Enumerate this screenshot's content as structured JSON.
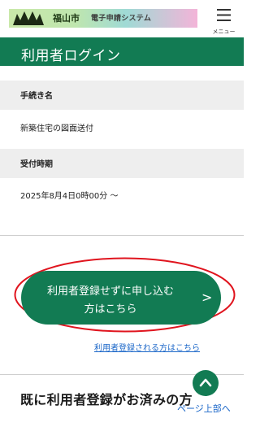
{
  "header": {
    "city_name": "福山市",
    "system_name": "電子申請システム",
    "menu_label": "メニュー"
  },
  "page_title": "利用者ログイン",
  "procedure": {
    "label": "手続き名",
    "value": "新築住宅の図面送付"
  },
  "reception_period": {
    "label": "受付時期",
    "value": "2025年8月4日0時00分 〜"
  },
  "apply_without_registration": {
    "line1": "利用者登録せずに申し込む",
    "line2": "方はこちら",
    "arrow": ">"
  },
  "registered_user_link": "利用者登録される方はこちら",
  "section_title": "既に利用者登録がお済みの方",
  "page_top_label": "ページ上部へ",
  "colors": {
    "primary_green": "#127b53",
    "highlight_red": "#e0141e",
    "link_blue": "#1a66c8"
  }
}
